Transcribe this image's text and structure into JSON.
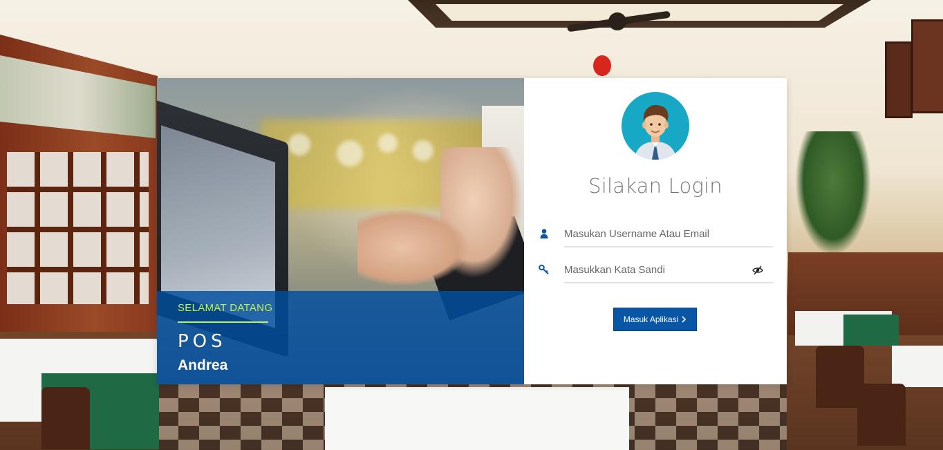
{
  "hero": {
    "welcome": "SELAMAT DATANG",
    "app_name": "POS",
    "app_owner": "Andrea"
  },
  "form": {
    "title": "Silakan Login",
    "username_placeholder": "Masukan Username Atau Email",
    "password_placeholder": "Masukkan Kata Sandi",
    "submit_label": "Masuk Aplikasi"
  },
  "icons": {
    "username": "user-icon",
    "password": "key-icon",
    "toggle_password": "eye-slash-icon",
    "submit": "chevron-right-icon",
    "avatar": "avatar-man-icon"
  },
  "colors": {
    "primary": "#0a56a6",
    "accent_green": "#c6f04d",
    "avatar_bg": "#16a8c4",
    "caption_overlay": "#004ea0"
  }
}
